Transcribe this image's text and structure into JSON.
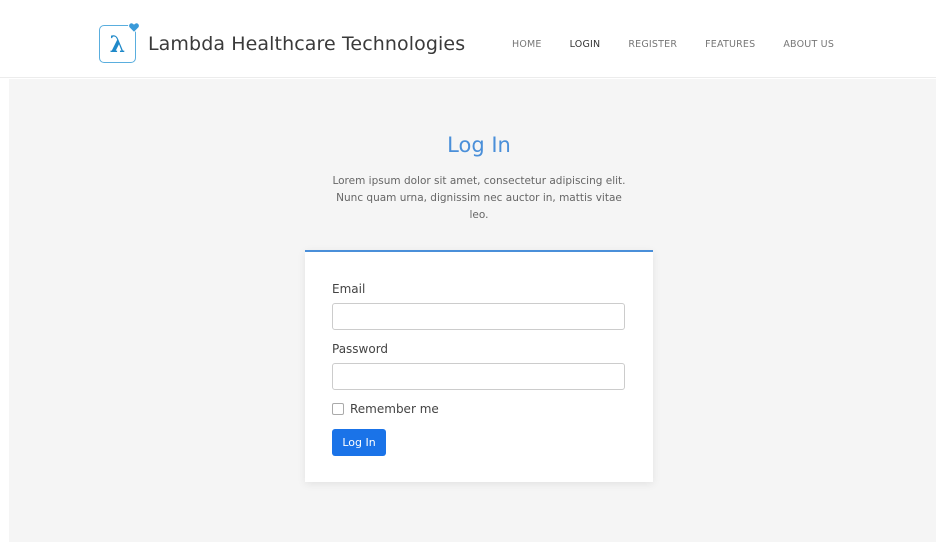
{
  "brand": {
    "logo_glyph": "λ",
    "logo_icon": "lambda-heart-logo",
    "name": "Lambda Healthcare Technologies"
  },
  "nav": {
    "items": [
      {
        "label": "HOME",
        "active": false
      },
      {
        "label": "LOGIN",
        "active": true
      },
      {
        "label": "REGISTER",
        "active": false
      },
      {
        "label": "FEATURES",
        "active": false
      },
      {
        "label": "ABOUT US",
        "active": false
      }
    ]
  },
  "page": {
    "title": "Log In",
    "intro": "Lorem ipsum dolor sit amet, consectetur adipiscing elit. Nunc quam urna, dignissim nec auctor in, mattis vitae leo."
  },
  "form": {
    "email_label": "Email",
    "email_value": "",
    "password_label": "Password",
    "password_value": "",
    "remember_label": "Remember me",
    "remember_checked": false,
    "submit_label": "Log In"
  },
  "colors": {
    "accent": "#4a8fd9",
    "button": "#1a73e8",
    "background": "#f5f5f5"
  }
}
